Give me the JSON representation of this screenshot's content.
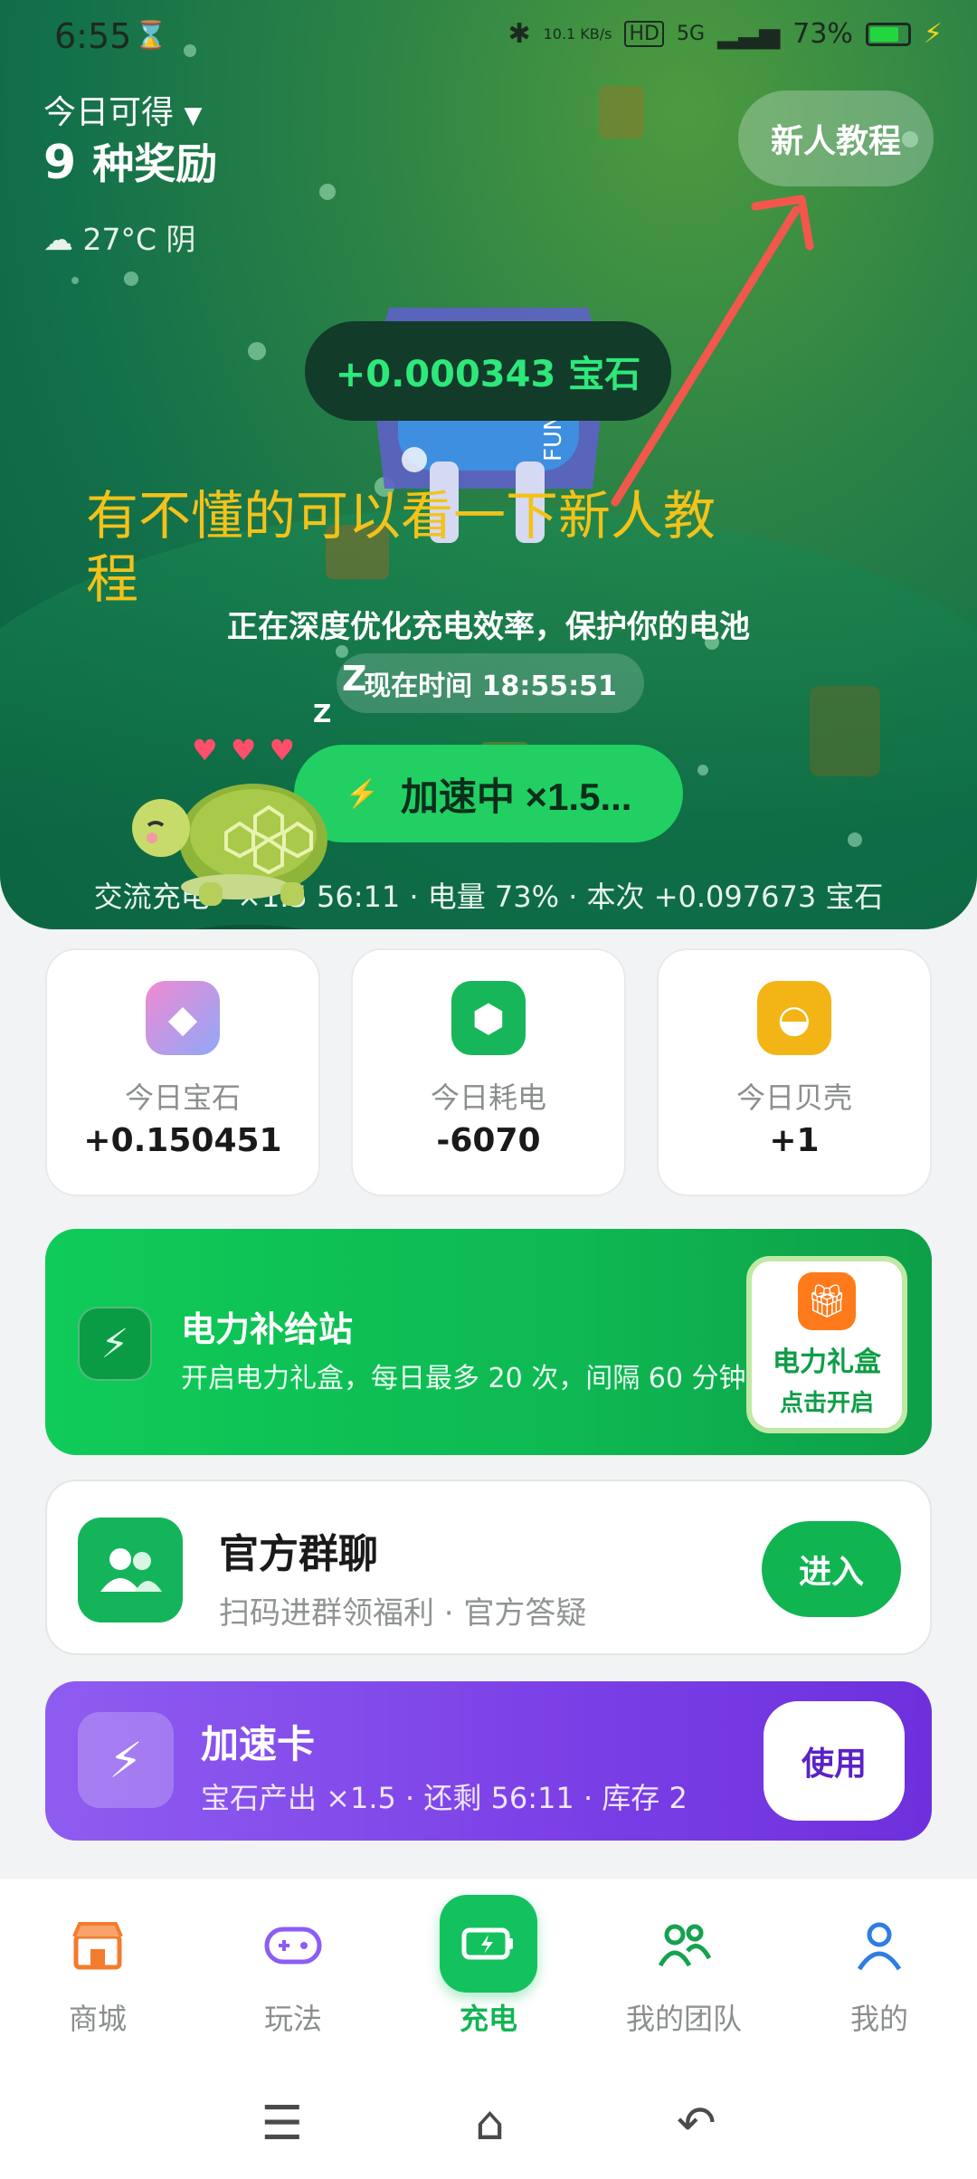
{
  "status_bar": {
    "time": "6:55",
    "net_speed": "10.1 KB/s",
    "signal": "5G",
    "battery": "73%"
  },
  "header": {
    "today_label": "今日可得",
    "reward_count": "9",
    "reward_unit": "种奖励",
    "weather": "27°C 阴",
    "tutorial_button": "新人教程"
  },
  "hero": {
    "gem_earned": "+0.000343 宝石",
    "annotation": "有不懂的可以看一下新人教程",
    "optimize_text": "正在深度优化充电效率，保护你的电池",
    "current_time": "现在时间 18:55:51",
    "speed_button": "加速中 ×1.5...",
    "summary": "交流充电 · ×1.5 56:11 · 电量 73% · 本次 +0.097673 宝石"
  },
  "stats": [
    {
      "label": "今日宝石",
      "value": "+0.150451",
      "icon": "diamond-icon",
      "color": "#e58bd8"
    },
    {
      "label": "今日耗电",
      "value": "-6070",
      "icon": "crystal-icon",
      "color": "#18b65a"
    },
    {
      "label": "今日贝壳",
      "value": "+1",
      "icon": "shell-icon",
      "color": "#f3b515"
    }
  ],
  "power_station": {
    "title": "电力补给站",
    "desc": "开启电力礼盒，每日最多 20 次，间隔 60 分钟",
    "gift_title": "电力礼盒",
    "gift_action": "点击开启"
  },
  "group_chat": {
    "title": "官方群聊",
    "desc": "扫码进群领福利 · 官方答疑",
    "button": "进入"
  },
  "boost_card": {
    "title": "加速卡",
    "desc": "宝石产出 ×1.5 · 还剩 56:11 · 库存 2",
    "button": "使用"
  },
  "nav": {
    "items": [
      {
        "label": "商城",
        "icon": "store-icon"
      },
      {
        "label": "玩法",
        "icon": "gamepad-icon"
      },
      {
        "label": "充电",
        "icon": "charge-icon"
      },
      {
        "label": "我的团队",
        "icon": "team-icon"
      },
      {
        "label": "我的",
        "icon": "profile-icon"
      }
    ],
    "active": "充电"
  },
  "colors": {
    "brand_green": "#13b455",
    "accent_purple": "#7b3fe6",
    "annotation_yellow": "#f3c21a"
  }
}
